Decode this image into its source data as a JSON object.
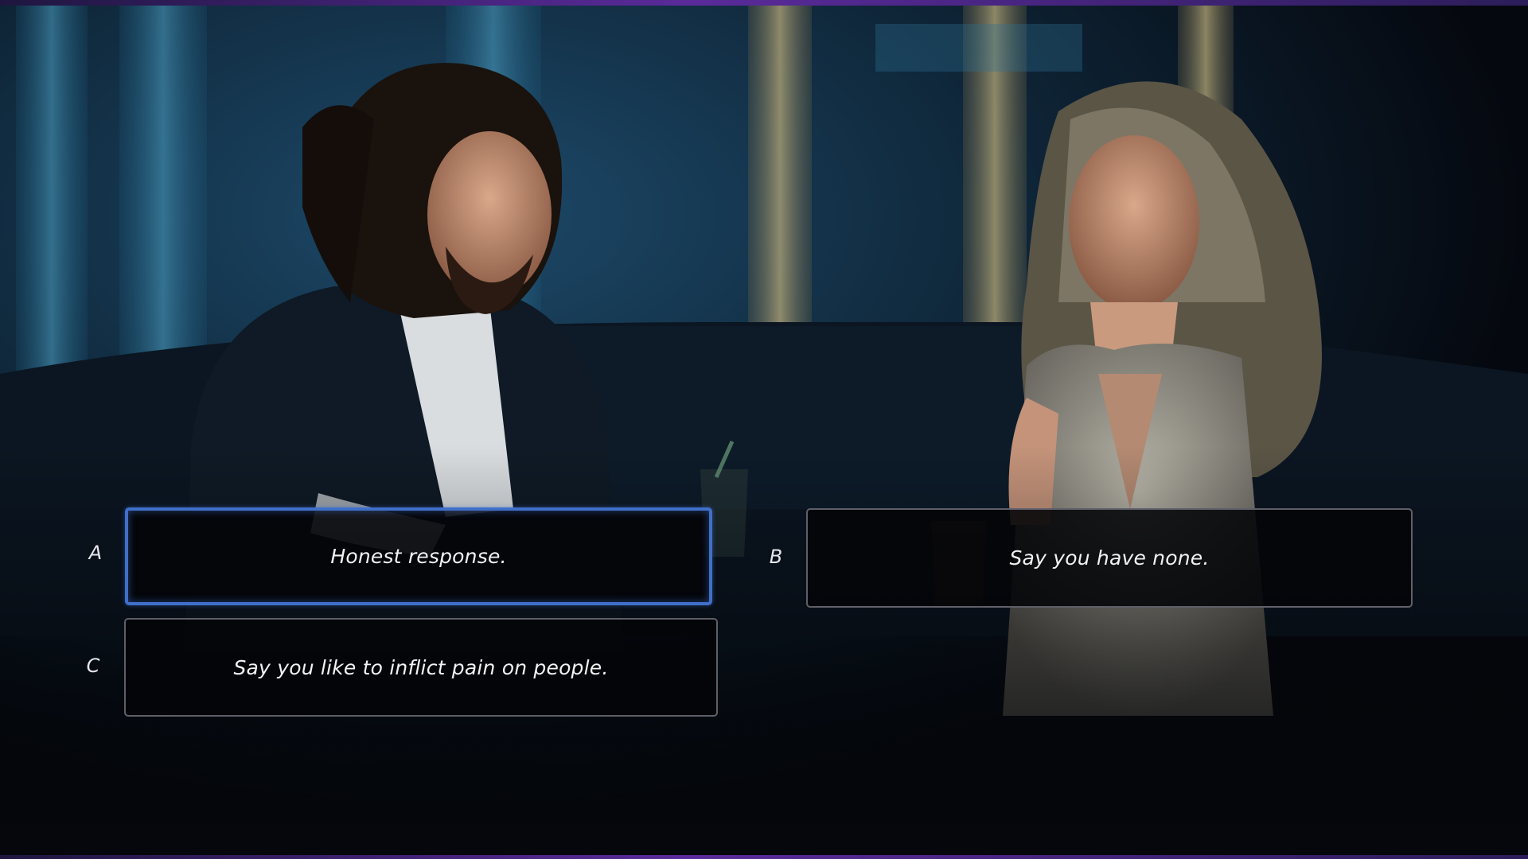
{
  "scene": {
    "description_icon": "fmv-scene-image",
    "accent_color": "#3f6fc9",
    "bar_color": "#5a2a9a"
  },
  "choices": [
    {
      "key": "A",
      "text": "Honest response.",
      "selected": true
    },
    {
      "key": "B",
      "text": "Say you have none.",
      "selected": false
    },
    {
      "key": "C",
      "text": "Say you like to inflict pain on people.",
      "selected": false
    }
  ]
}
